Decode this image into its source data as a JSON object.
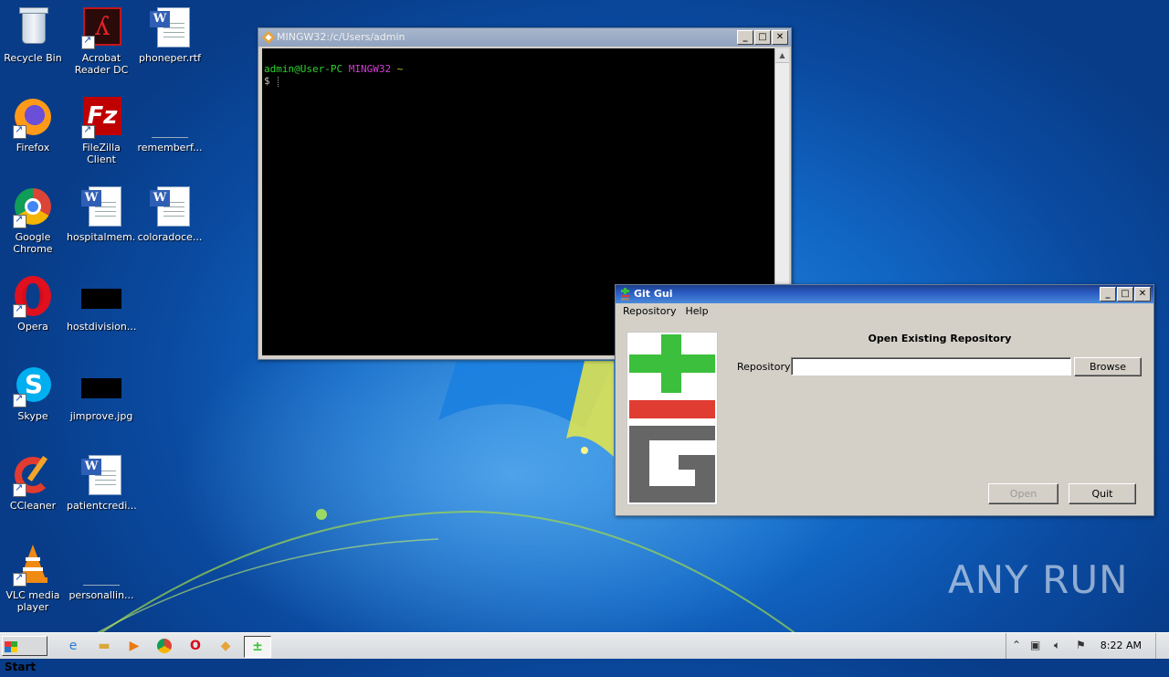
{
  "desktop": {
    "icons": [
      {
        "label": "Recycle Bin"
      },
      {
        "label": "Acrobat Reader DC"
      },
      {
        "label": "phoneper.rtf"
      },
      {
        "label": "Firefox"
      },
      {
        "label": "FileZilla Client"
      },
      {
        "label": "rememberf..."
      },
      {
        "label": "Google Chrome"
      },
      {
        "label": "hospitalmem..."
      },
      {
        "label": "coloradoce..."
      },
      {
        "label": "Opera"
      },
      {
        "label": "hostdivision..."
      },
      {
        "label": "Skype"
      },
      {
        "label": "jimprove.jpg"
      },
      {
        "label": "CCleaner"
      },
      {
        "label": "patientcredi..."
      },
      {
        "label": "VLC media player"
      },
      {
        "label": "personallin..."
      }
    ]
  },
  "terminal": {
    "title": "MINGW32:/c/Users/admin",
    "prompt_user": "admin@User-PC",
    "prompt_env": "MINGW32",
    "prompt_path": "~",
    "prompt_symbol": "$"
  },
  "gitgui": {
    "title": "Git Gui",
    "menu": [
      "Repository",
      "Help"
    ],
    "heading": "Open Existing Repository",
    "repo_label": "Repository:",
    "repo_value": "",
    "browse_label": "Browse",
    "open_label": "Open",
    "quit_label": "Quit"
  },
  "taskbar": {
    "start_label": "Start",
    "clock": "8:22 AM"
  },
  "watermark": "ANY RUN",
  "colors": {
    "desktop_blue": "#1166c4",
    "title_active": "#2a5ac2",
    "git_green": "#3cbf3c",
    "git_red": "#e03c31",
    "git_gray": "#666666"
  }
}
